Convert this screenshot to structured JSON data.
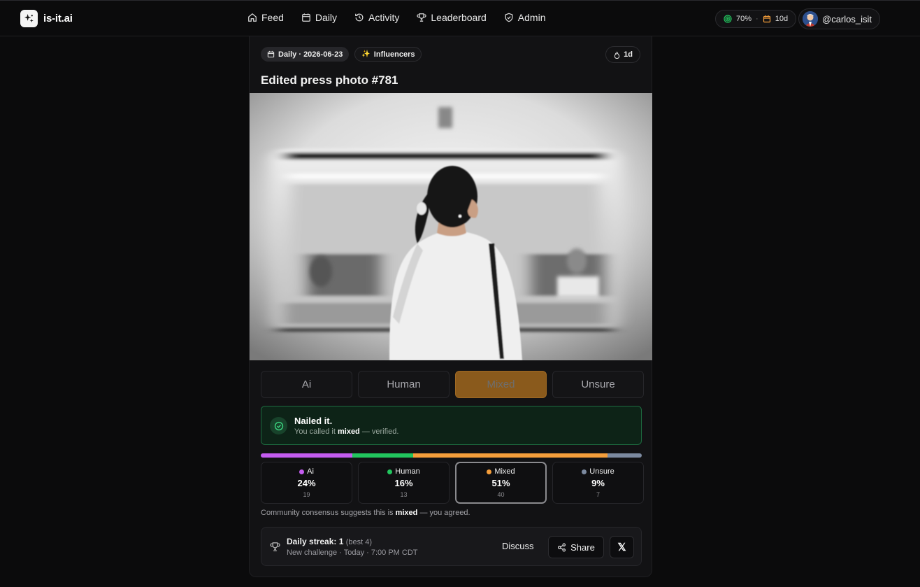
{
  "brand": {
    "name": "is-it.ai"
  },
  "nav": {
    "items": [
      {
        "label": "Feed",
        "icon": "home-icon"
      },
      {
        "label": "Daily",
        "icon": "calendar-icon"
      },
      {
        "label": "Activity",
        "icon": "history-icon"
      },
      {
        "label": "Leaderboard",
        "icon": "trophy-icon"
      },
      {
        "label": "Admin",
        "icon": "shield-icon"
      }
    ]
  },
  "header": {
    "accuracy": "70%",
    "separator": "·",
    "streak": "10d",
    "username": "@carlos_isit"
  },
  "card": {
    "date_tag": "Daily · 2026-06-23",
    "category_tag": "Influencers",
    "age": "1d",
    "title": "Edited press photo #781"
  },
  "vote": {
    "options": [
      {
        "label": "Ai",
        "selected": false
      },
      {
        "label": "Human",
        "selected": false
      },
      {
        "label": "Mixed",
        "selected": true
      },
      {
        "label": "Unsure",
        "selected": false
      }
    ],
    "selected_color": "#8a5a1c"
  },
  "result": {
    "title": "Nailed it.",
    "sub_prefix": "You called it",
    "answer": "mixed",
    "sub_suffix": "— verified.",
    "color": "#1d6a3f"
  },
  "distribution": [
    {
      "label": "Ai",
      "percent": "24%",
      "value": 24,
      "count": "19",
      "color": "#c45cf0",
      "selected": false
    },
    {
      "label": "Human",
      "percent": "16%",
      "value": 16,
      "count": "13",
      "color": "#22c55e",
      "selected": false
    },
    {
      "label": "Mixed",
      "percent": "51%",
      "value": 51,
      "count": "40",
      "color": "#f59e3b",
      "selected": true
    },
    {
      "label": "Unsure",
      "percent": "9%",
      "value": 9,
      "count": "7",
      "color": "#7c8aa0",
      "selected": false
    }
  ],
  "consensus": {
    "prefix": "Community consensus suggests this is",
    "answer": "mixed",
    "suffix": "— you agreed."
  },
  "footer": {
    "streak_label": "Daily streak: 1",
    "best": "(best 4)",
    "next": "New challenge · Today · 7:00 PM CDT",
    "discuss": "Discuss",
    "share": "Share",
    "x": "𝕏"
  }
}
